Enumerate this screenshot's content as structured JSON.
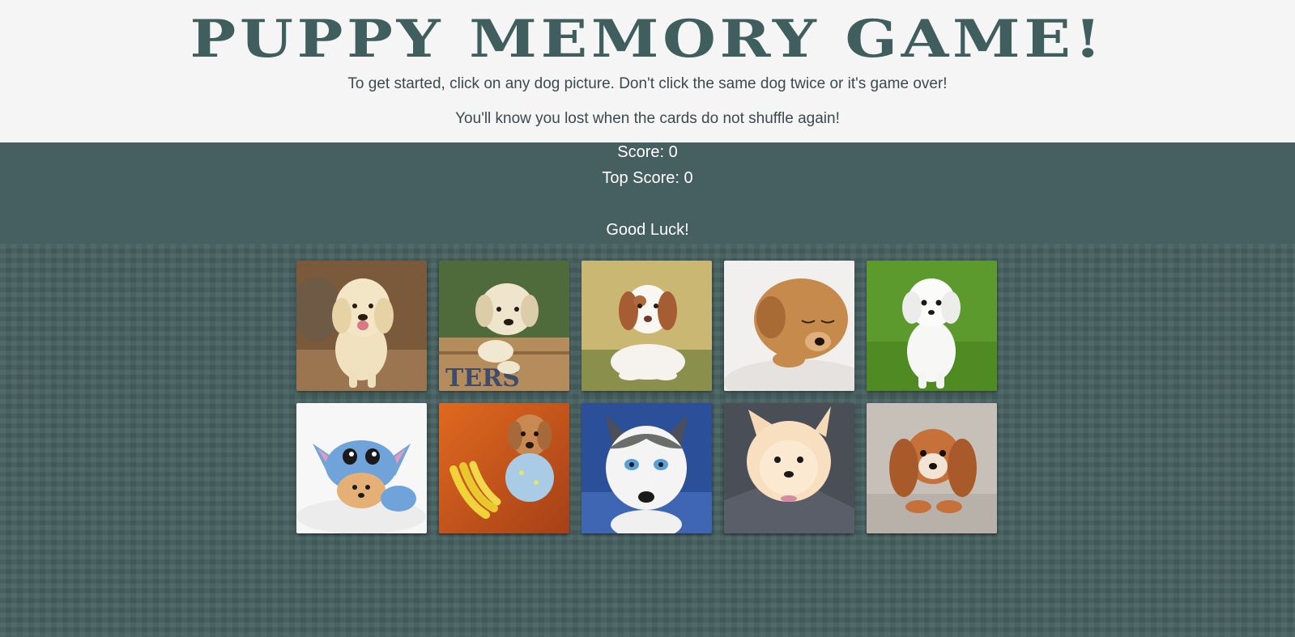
{
  "header": {
    "title": "PUPPY MEMORY GAME!",
    "instruction_1": "To get started, click on any dog picture. Don't click the same dog twice or it's game over!",
    "instruction_2": "You'll know you lost when the cards do not shuffle again!"
  },
  "scoreboard": {
    "score_text": "Score: 0",
    "top_score_text": "Top Score: 0",
    "good_luck": "Good Luck!",
    "score": 0,
    "top_score": 0
  },
  "colors": {
    "header_bg": "#f5f5f5",
    "accent": "#3f5e5d",
    "board_bg": "#465f60",
    "score_text": "#ffffff"
  },
  "cards": [
    {
      "name": "golden-retriever-puppy-walking",
      "icon": "puppy-photo"
    },
    {
      "name": "labrador-puppy-in-crate",
      "icon": "puppy-photo"
    },
    {
      "name": "brittany-spaniel-puppy-on-grass",
      "icon": "puppy-photo"
    },
    {
      "name": "sleeping-brown-puppy",
      "icon": "puppy-photo"
    },
    {
      "name": "white-maltese-puppy-on-grass",
      "icon": "puppy-photo"
    },
    {
      "name": "pomeranian-in-stitch-costume",
      "icon": "puppy-photo"
    },
    {
      "name": "puppy-in-pajamas-with-bananas",
      "icon": "puppy-photo"
    },
    {
      "name": "husky-puppy-blue-eyes",
      "icon": "puppy-photo"
    },
    {
      "name": "fluffy-pomeranian-puppy",
      "icon": "puppy-photo"
    },
    {
      "name": "cavalier-king-charles-puppy",
      "icon": "puppy-photo"
    }
  ]
}
